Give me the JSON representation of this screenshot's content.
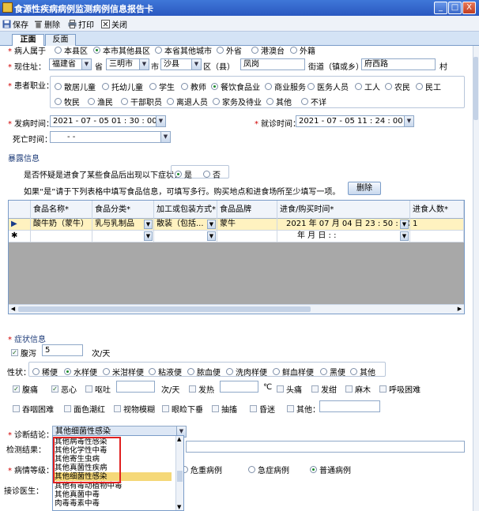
{
  "window": {
    "title": "食源性疾病病例监测病例信息报告卡",
    "minimize": "_",
    "maximize": "□",
    "close": "X"
  },
  "toolbar": {
    "save": "保存",
    "delete": "删除",
    "print": "打印",
    "close": "关闭"
  },
  "tabs": [
    "正面",
    "反面"
  ],
  "patient_origin": {
    "label": "病人属于",
    "options": [
      "本县区",
      "本市其他县区",
      "本省其他城市",
      "外省",
      "港澳台",
      "外籍"
    ],
    "selected": 1
  },
  "address": {
    "label": "现住址：",
    "province_value": "福建省",
    "province_unit": "省",
    "city_value": "三明市",
    "city_unit": "市",
    "district_value": "沙县",
    "district_unit": "区（县）",
    "town_value": "凤岗",
    "street_label": "街道（镇或乡）",
    "street_value": "府西路",
    "village_unit": "村"
  },
  "occupation": {
    "label": "患者职业：",
    "row1": [
      "散居儿童",
      "托幼儿童",
      "学生",
      "教师",
      "餐饮食品业",
      "商业服务",
      "医务人员",
      "工人",
      "农民",
      "民工"
    ],
    "row2": [
      "牧民",
      "渔民",
      "干部职员",
      "离退人员",
      "家务及待业",
      "其他",
      "不详"
    ],
    "selected": "餐饮食品业"
  },
  "onset": {
    "label": "发病时间：",
    "value": "2021 - 07 - 05  01 : 30 : 00"
  },
  "visit": {
    "label": "就诊时间：",
    "value": "2021 - 07 - 05  11 : 24 : 00"
  },
  "death": {
    "label": "死亡时间：",
    "value": "-  -"
  },
  "exposure": {
    "section_title": "暴露信息",
    "question": "是否怀疑是进食了某些食品后出现以下症状：",
    "yes": "是",
    "no": "否",
    "hint": "如果“是”请于下列表格中填写食品信息，可填写多行。购买地点和进食场所至少填写一项。",
    "delete_button": "删除"
  },
  "food_table": {
    "headers": [
      "食品名称*",
      "食品分类*",
      "加工或包装方式*",
      "食品品牌",
      "进食/购买时间*",
      "进食人数*"
    ],
    "rows": [
      {
        "marker": "▶",
        "cells": [
          "酸牛奶（蒙牛）",
          "乳与乳制品",
          "散装（包括...",
          "蒙牛",
          "2021 年 07 月 04 日  23 : 50 : 00",
          "1"
        ]
      },
      {
        "marker": "✱",
        "cells": [
          "",
          "",
          "",
          "",
          "年    月    日    :    :",
          ""
        ]
      }
    ]
  },
  "symptoms": {
    "section_title": "症状信息",
    "diarrhea_label": "腹泻",
    "diarrhea_count": "5",
    "diarrhea_unit": "次/天",
    "stool_label": "性状：",
    "stool_options": [
      "稀便",
      "水样便",
      "米泔样便",
      "粘液便",
      "脓血便",
      "洗肉样便",
      "鲜血样便",
      "黑便",
      "其他"
    ],
    "stool_selected": "水样便",
    "row1": [
      {
        "label": "腹痛",
        "checked": true
      },
      {
        "label": "恶心",
        "checked": true
      },
      {
        "label": "呕吐",
        "checked": false
      }
    ],
    "vomit_unit": "次/天",
    "fever_label": "发热",
    "fever_unit": "℃",
    "row1b": [
      "头痛",
      "发绀",
      "麻木",
      "呼吸困难"
    ],
    "row2": [
      "吞咽困难",
      "面色潮红",
      "视物模糊",
      "眼睑下垂",
      "抽搐",
      "昏迷",
      "其他："
    ]
  },
  "diagnosis": {
    "label": "诊断结论：",
    "value": "其他细菌性感染",
    "lab_label": "检测结果：",
    "severity_label": "病情等级：",
    "severity_options": [
      "危重病例",
      "急症病例",
      "普通病例"
    ],
    "severity_selected": "普通病例",
    "doctor_label": "接诊医生：",
    "list_items": [
      "其他病毒性感染",
      "其他化学性中毒",
      "其他寄生虫病",
      "其他真菌性疾病",
      "其他细菌性感染",
      "其他有毒动植物中毒",
      "其他真菌中毒",
      "肉毒毒素中毒"
    ],
    "highlighted": "其他细菌性感染"
  }
}
